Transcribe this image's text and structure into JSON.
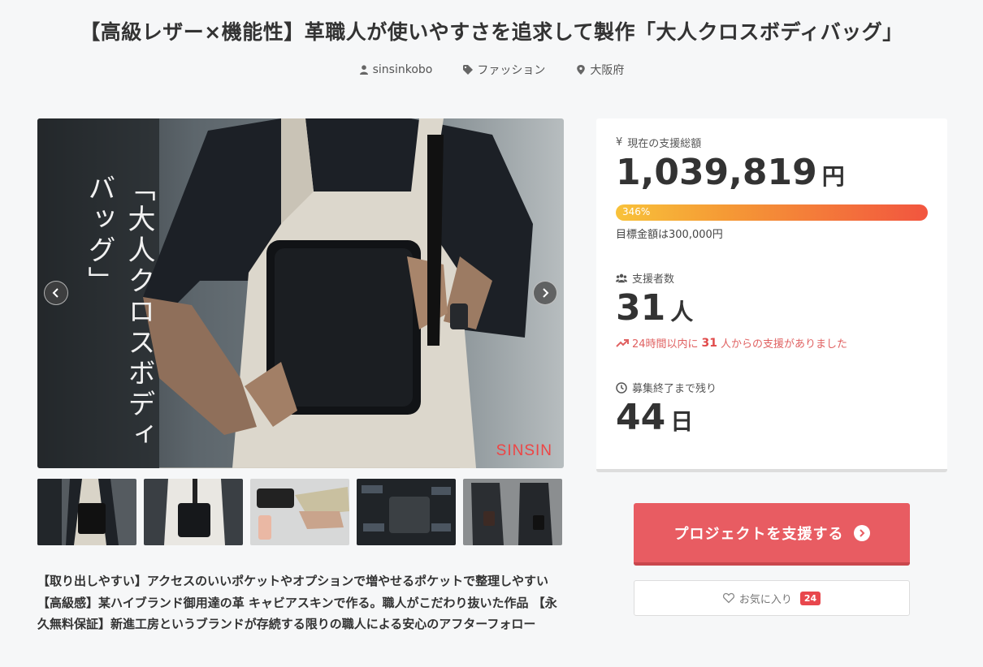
{
  "project": {
    "title": "【高級レザー×機能性】革職人が使いやすさを追求して製作「大人クロスボディバッグ」",
    "owner": "sinsinkobo",
    "category": "ファッション",
    "location": "大阪府"
  },
  "hero": {
    "caption": "「大人クロスボディバッグ」",
    "logo": "SINSIN",
    "thumbnails_count": 5
  },
  "description": "【取り出しやすい】アクセスのいいポケットやオプションで増やせるポケットで整理しやすい 【高級感】某ハイブランド御用達の革 キャビアスキンで作る。職人がこだわり抜いた作品 【永久無料保証】新進工房というブランドが存続する限りの職人による安心のアフターフォロー",
  "stats": {
    "funding_label": "現在の支援総額",
    "funding_amount": "1,039,819",
    "funding_unit": "円",
    "progress_percent": "346%",
    "progress_value": 346,
    "goal_text": "目標金額は300,000円",
    "backers_label": "支援者数",
    "backers_count": "31",
    "backers_unit": "人",
    "trend_prefix": "24時間以内に",
    "trend_count": "31",
    "trend_suffix": "人からの支援がありました",
    "remaining_label": "募集終了まで残り",
    "remaining_days": "44",
    "remaining_unit": "日"
  },
  "actions": {
    "support_label": "プロジェクトを支援する",
    "favorite_label": "お気に入り",
    "favorite_count": "24"
  },
  "colors": {
    "accent": "#e85c62",
    "progress_start": "#f8c23a",
    "progress_end": "#f2553f",
    "trend": "#e06161"
  }
}
